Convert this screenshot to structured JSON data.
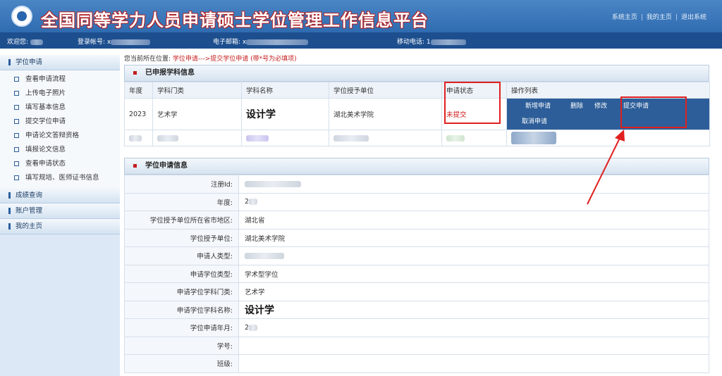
{
  "header": {
    "title": "全国同等学力人员申请硕士学位管理工作信息平台",
    "links": [
      "系统主页",
      "我的主页",
      "退出系统"
    ],
    "separator": "|"
  },
  "infobar": {
    "welcome_label": "欢迎您:",
    "account_label": "登录帐号:",
    "account_prefix": "x",
    "email_label": "电子邮箱:",
    "email_prefix": "x",
    "phone_label": "移动电话:",
    "phone_prefix": "1"
  },
  "sidebar": {
    "sections": [
      {
        "label": "学位申请",
        "items": [
          "查看申请流程",
          "上传电子照片",
          "填写基本信息",
          "提交学位申请",
          "申请论文答辩资格",
          "填报论文信息",
          "查看申请状态",
          "填写规培、医师证书信息"
        ]
      },
      {
        "label": "成绩查询",
        "items": []
      },
      {
        "label": "账户管理",
        "items": []
      },
      {
        "label": "我的主页",
        "items": []
      }
    ]
  },
  "breadcrumb": {
    "prefix": "您当前所在位置:",
    "path": "学位申请--->提交学位申请",
    "note": "(带*号为必填项)"
  },
  "subjects": {
    "title": "已申报学科信息",
    "columns": [
      "年度",
      "学科门类",
      "学科名称",
      "学位授予单位",
      "申请状态",
      "操作列表"
    ],
    "row": {
      "year": "2023",
      "category": "艺术学",
      "subject": "设计学",
      "unit": "湖北美术学院",
      "status": "未提交"
    },
    "ops": [
      "新增申请",
      "删除",
      "修改",
      "提交申请",
      "取消申请"
    ]
  },
  "application": {
    "title": "学位申请信息",
    "fields": [
      {
        "label": "注册Id:",
        "value": ""
      },
      {
        "label": "年度:",
        "value": "2"
      },
      {
        "label": "学位授予单位所在省市地区:",
        "value": "湖北省"
      },
      {
        "label": "学位授予单位:",
        "value": "湖北美术学院"
      },
      {
        "label": "申请人类型:",
        "value": ""
      },
      {
        "label": "申请学位类型:",
        "value": "学术型学位"
      },
      {
        "label": "申请学位学科门类:",
        "value": "艺术学"
      },
      {
        "label": "申请学位学科名称:",
        "value": "设计学"
      },
      {
        "label": "学位申请年月:",
        "value": "2"
      },
      {
        "label": "学号:",
        "value": ""
      },
      {
        "label": "班级:",
        "value": ""
      }
    ]
  },
  "colors": {
    "annotation": "#e02020",
    "header": "#3a78bd",
    "infobar": "#1d4f8f",
    "status": "#d11e1e"
  }
}
